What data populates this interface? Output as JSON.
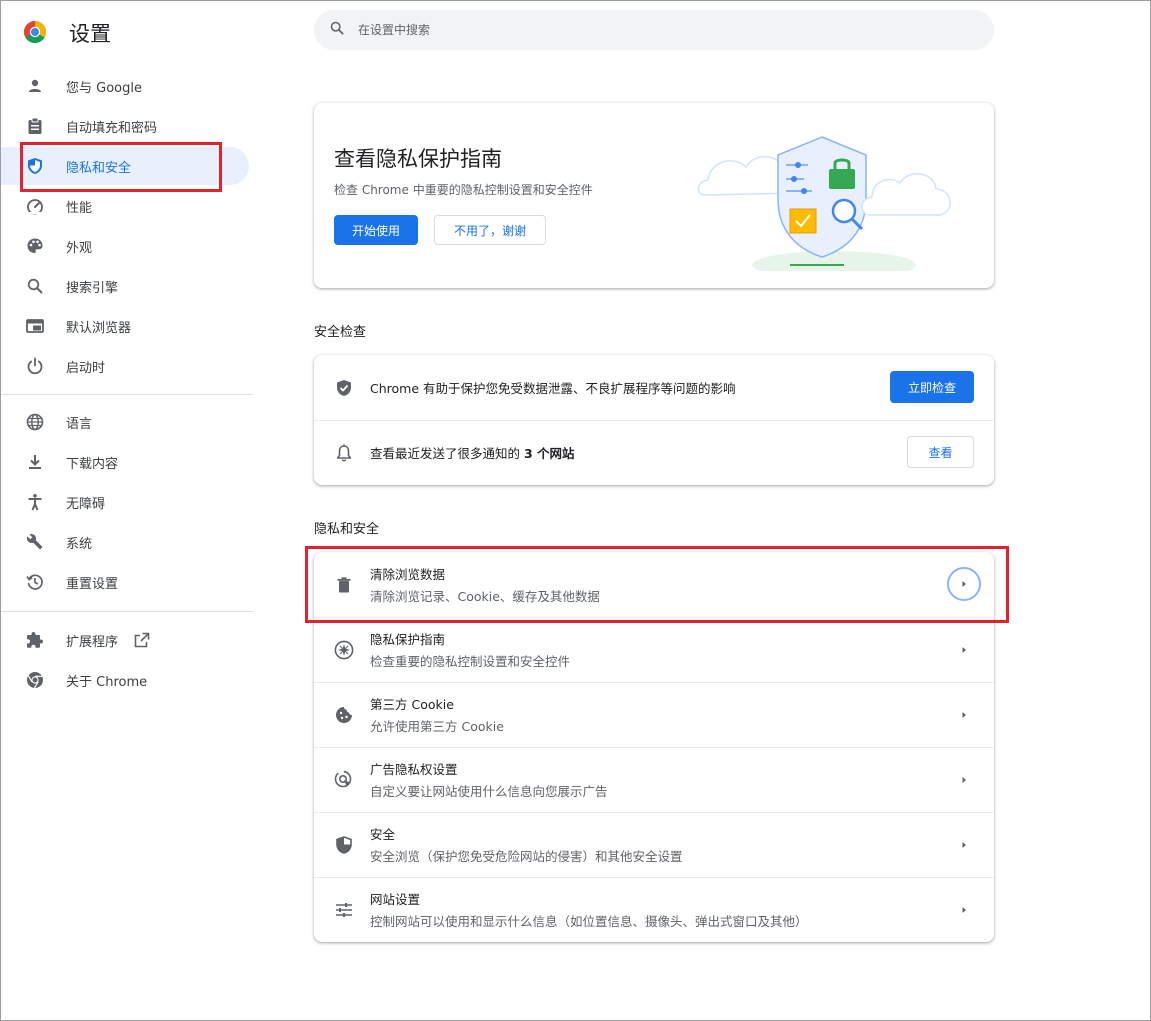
{
  "app": {
    "title": "设置"
  },
  "search": {
    "placeholder": "在设置中搜索"
  },
  "sidebar": {
    "items": [
      {
        "label": "您与 Google",
        "icon": "person-icon"
      },
      {
        "label": "自动填充和密码",
        "icon": "clipboard-icon"
      },
      {
        "label": "隐私和安全",
        "icon": "shield-icon",
        "active": true
      },
      {
        "label": "性能",
        "icon": "speedometer-icon"
      },
      {
        "label": "外观",
        "icon": "palette-icon"
      },
      {
        "label": "搜索引擎",
        "icon": "search-icon"
      },
      {
        "label": "默认浏览器",
        "icon": "browser-icon"
      },
      {
        "label": "启动时",
        "icon": "power-icon"
      },
      {
        "label": "语言",
        "icon": "globe-icon"
      },
      {
        "label": "下载内容",
        "icon": "download-icon"
      },
      {
        "label": "无障碍",
        "icon": "accessibility-icon"
      },
      {
        "label": "系统",
        "icon": "wrench-icon"
      },
      {
        "label": "重置设置",
        "icon": "reset-history-icon"
      },
      {
        "label": "扩展程序",
        "icon": "puzzle-icon"
      },
      {
        "label": "关于 Chrome",
        "icon": "chrome-icon"
      }
    ]
  },
  "promo": {
    "title": "查看隐私保护指南",
    "description": "检查 Chrome 中重要的隐私控制设置和安全控件",
    "start_button": "开始使用",
    "dismiss_button": "不用了，谢谢"
  },
  "safety_check": {
    "section_title": "安全检查",
    "rows": [
      {
        "text": "Chrome 有助于保护您免受数据泄露、不良扩展程序等问题的影响",
        "button": "立即检查",
        "icon": "shield-check-icon"
      },
      {
        "text_prefix": "查看最近发送了很多通知的 ",
        "text_bold": "3 个网站",
        "button": "查看",
        "icon": "bell-icon"
      }
    ]
  },
  "privacy": {
    "section_title": "隐私和安全",
    "rows": [
      {
        "title": "清除浏览数据",
        "subtitle": "清除浏览记录、Cookie、缓存及其他数据",
        "icon": "trash-icon"
      },
      {
        "title": "隐私保护指南",
        "subtitle": "检查重要的隐私控制设置和安全控件",
        "icon": "compass-icon"
      },
      {
        "title": "第三方 Cookie",
        "subtitle": "允许使用第三方 Cookie",
        "icon": "cookie-icon"
      },
      {
        "title": "广告隐私权设置",
        "subtitle": "自定义要让网站使用什么信息向您展示广告",
        "icon": "ad-privacy-icon"
      },
      {
        "title": "安全",
        "subtitle": "安全浏览（保护您免受危险网站的侵害）和其他安全设置",
        "icon": "shield-half-icon"
      },
      {
        "title": "网站设置",
        "subtitle": "控制网站可以使用和显示什么信息（如位置信息、摄像头、弹出式窗口及其他）",
        "icon": "sliders-icon"
      }
    ]
  },
  "colors": {
    "accent": "#1a73e8",
    "highlight_red": "#e2232f",
    "active_bg": "#e8f0fe"
  }
}
